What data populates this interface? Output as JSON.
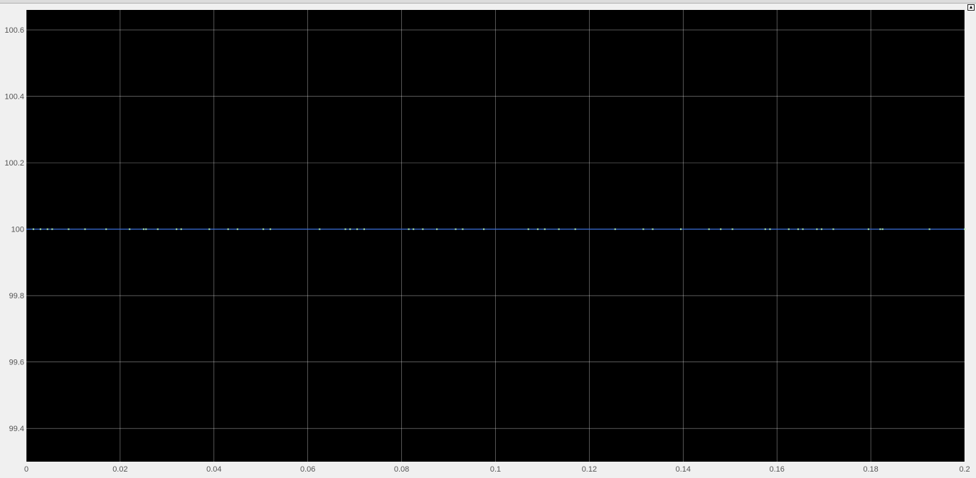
{
  "window": {
    "corner_button_icon": "expand-icon"
  },
  "chart_data": {
    "type": "line",
    "title": "",
    "xlabel": "",
    "ylabel": "",
    "xlim": [
      0,
      0.2
    ],
    "ylim": [
      99.3,
      100.66
    ],
    "x_ticks": [
      "0",
      "0.02",
      "0.04",
      "0.06",
      "0.08",
      "0.1",
      "0.12",
      "0.14",
      "0.16",
      "0.18",
      "0.2"
    ],
    "y_ticks": [
      "100.6",
      "100.4",
      "100.2",
      "100",
      "99.8",
      "99.6",
      "99.4"
    ],
    "grid": true,
    "background_color": "#000000",
    "grid_color": "#ffffff",
    "series": [
      {
        "color": "#3a6fd8",
        "x": [
          0,
          0.2
        ],
        "y": [
          100,
          100
        ]
      }
    ],
    "marker_color": "#b5f3b5",
    "marker_x": [
      0.0015,
      0.003,
      0.0045,
      0.0055,
      0.009,
      0.0125,
      0.017,
      0.022,
      0.025,
      0.0255,
      0.028,
      0.032,
      0.033,
      0.039,
      0.043,
      0.045,
      0.0505,
      0.052,
      0.0625,
      0.068,
      0.069,
      0.0705,
      0.072,
      0.0815,
      0.0825,
      0.0845,
      0.0875,
      0.0915,
      0.093,
      0.0975,
      0.107,
      0.109,
      0.1105,
      0.1135,
      0.117,
      0.1255,
      0.1315,
      0.1335,
      0.1395,
      0.1455,
      0.148,
      0.1505,
      0.1575,
      0.1585,
      0.1625,
      0.1645,
      0.1655,
      0.1685,
      0.1695,
      0.172,
      0.1795,
      0.182,
      0.1825,
      0.1925,
      0.2
    ]
  }
}
